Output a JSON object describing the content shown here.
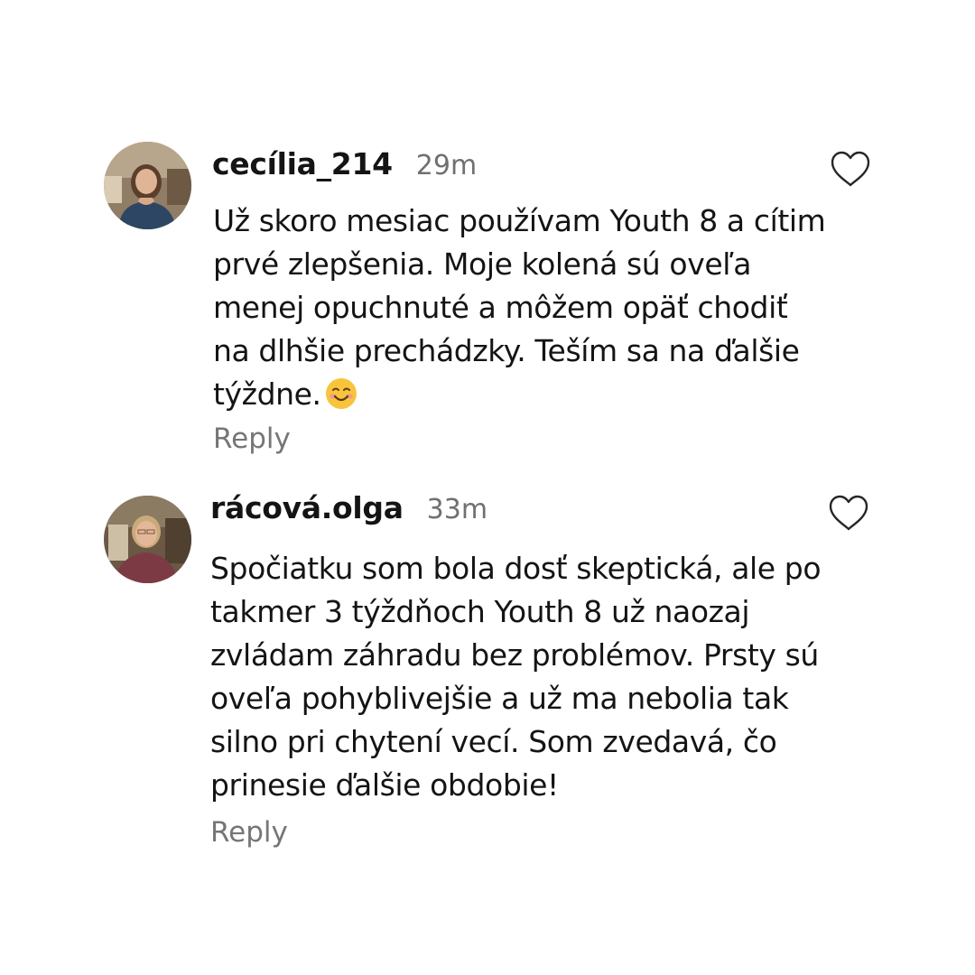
{
  "comments": [
    {
      "username": "cecília_214",
      "time": "29m",
      "text": "Už skoro mesiac používam Youth 8 a cítim\nprvé zlepšenia. Moje kolená sú oveľa\nmenej opuchnuté a môžem opäť chodiť\nna dlhšie prechádzky. Teším sa na ďalšie\ntýždne.",
      "emoji": "smiling-face-icon",
      "reply_label": "Reply",
      "like_icon": "heart-outline-icon"
    },
    {
      "username": "rácová.olga",
      "time": "33m",
      "text": "Spočiatku som bola dosť skeptická, ale po\ntakmer 3 týždňoch Youth 8 už naozaj\nzvládam záhradu bez problémov. Prsty sú\noveľa pohyblivejšie a už ma nebolia tak\nsilno pri chytení vecí. Som zvedavá, čo\nprinesie ďalšie obdobie!",
      "reply_label": "Reply",
      "like_icon": "heart-outline-icon"
    }
  ],
  "colors": {
    "text": "#141414",
    "muted": "#707070",
    "background": "#ffffff"
  }
}
